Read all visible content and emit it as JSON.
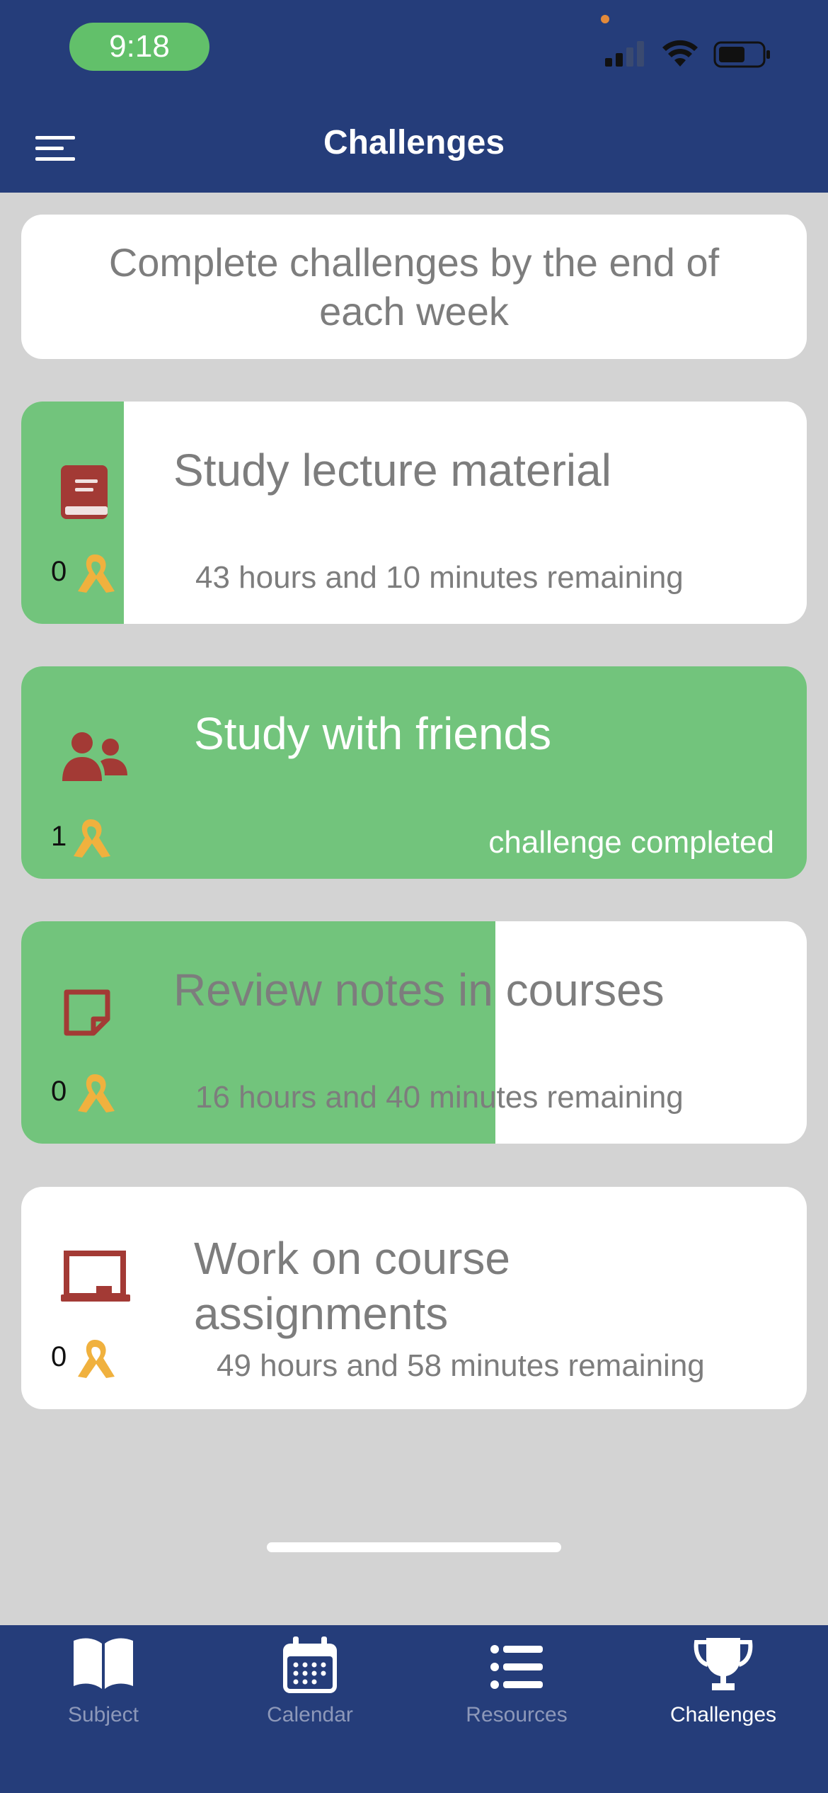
{
  "status": {
    "time": "9:18"
  },
  "header": {
    "title": "Challenges"
  },
  "banner": {
    "text": "Complete challenges by the end of each week"
  },
  "challenges": [
    {
      "title": "Study lecture material",
      "subtitle": "43 hours and 10 minutes remaining",
      "count": "0",
      "icon": "book-icon",
      "progress": 0.13,
      "completed": false
    },
    {
      "title": "Study with friends",
      "subtitle": "challenge completed",
      "count": "1",
      "icon": "users-icon",
      "progress": 1.0,
      "completed": true
    },
    {
      "title": "Review notes in courses",
      "subtitle": "16 hours and 40 minutes remaining",
      "count": "0",
      "icon": "sticky-note-icon",
      "progress": 0.6,
      "completed": false
    },
    {
      "title": "Work on course assignments",
      "subtitle": "49 hours and 58 minutes remaining",
      "count": "0",
      "icon": "chalkboard-icon",
      "progress": 0.0,
      "completed": false
    }
  ],
  "tabs": [
    {
      "label": "Subject",
      "icon": "book-open-icon",
      "active": false
    },
    {
      "label": "Calendar",
      "icon": "calendar-icon",
      "active": false
    },
    {
      "label": "Resources",
      "icon": "list-icon",
      "active": false
    },
    {
      "label": "Challenges",
      "icon": "trophy-icon",
      "active": true
    }
  ],
  "colors": {
    "header": "#253d7a",
    "progress": "#72c47c",
    "icon": "#a33a35",
    "ribbon": "#f0b13e",
    "background": "#d3d3d3"
  }
}
